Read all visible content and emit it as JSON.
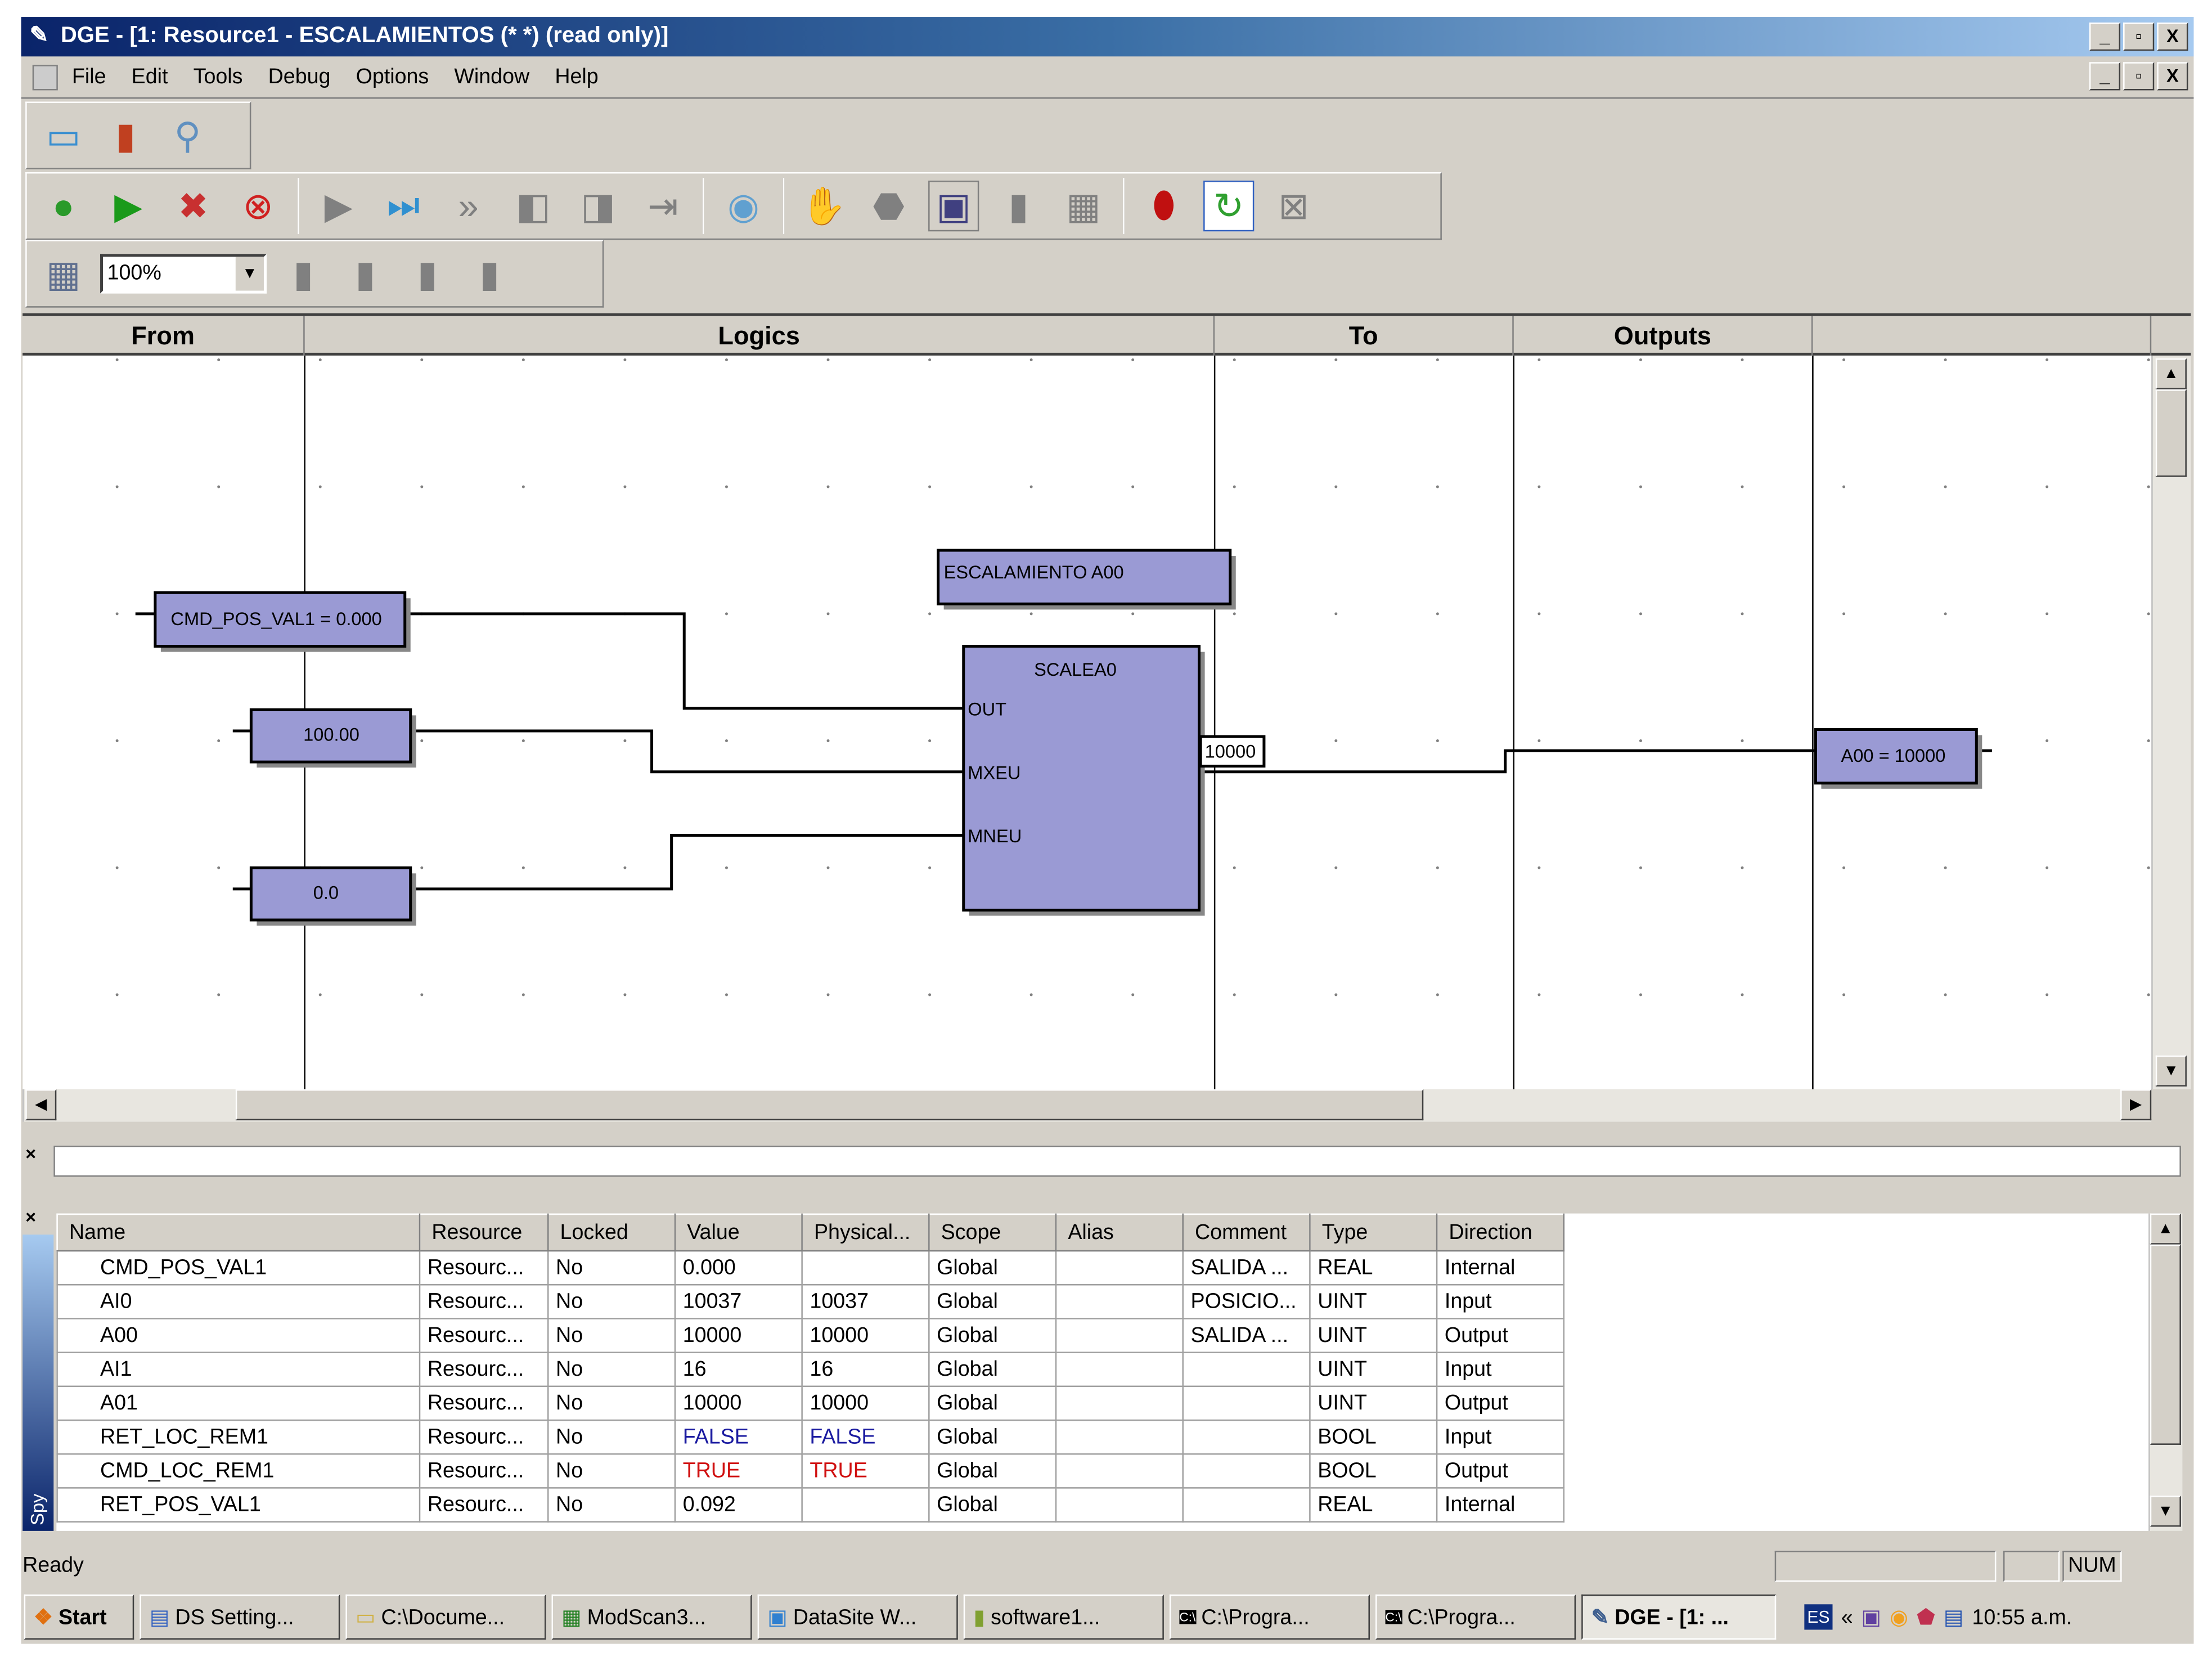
{
  "window": {
    "title": "DGE - [1: Resource1 - ESCALAMIENTOS (* *) (read only)]",
    "min": "_",
    "restore": "▫",
    "close": "X"
  },
  "menu": [
    "File",
    "Edit",
    "Tools",
    "Debug",
    "Options",
    "Window",
    "Help"
  ],
  "toolbar": {
    "zoom_value": "100%"
  },
  "diagram": {
    "columns": [
      "From",
      "Logics",
      "To",
      "Outputs",
      ""
    ],
    "blocks": {
      "cmd_pos": "CMD_POS_VAL1 = 0.000",
      "mxeu_const": "100.00",
      "mneu_const": "0.0",
      "comment": "ESCALAMIENTO A00",
      "fb_name": "SCALEA0",
      "pin_out": "OUT",
      "pin_mxeu": "MXEU",
      "pin_mneu": "MNEU",
      "out_value": "10000",
      "output": "A00 = 10000"
    }
  },
  "spy": {
    "label": "Spy",
    "columns": [
      "Name",
      "Resource",
      "Locked",
      "Value",
      "Physical...",
      "Scope",
      "Alias",
      "Comment",
      "Type",
      "Direction"
    ],
    "rows": [
      [
        "CMD_POS_VAL1",
        "Resourc...",
        "No",
        "0.000",
        "",
        "Global",
        "",
        "SALIDA ...",
        "REAL",
        "Internal"
      ],
      [
        "AI0",
        "Resourc...",
        "No",
        "10037",
        "10037",
        "Global",
        "",
        "POSICIO...",
        "UINT",
        "Input"
      ],
      [
        "A00",
        "Resourc...",
        "No",
        "10000",
        "10000",
        "Global",
        "",
        "SALIDA ...",
        "UINT",
        "Output"
      ],
      [
        "AI1",
        "Resourc...",
        "No",
        "16",
        "16",
        "Global",
        "",
        "",
        "UINT",
        "Input"
      ],
      [
        "A01",
        "Resourc...",
        "No",
        "10000",
        "10000",
        "Global",
        "",
        "",
        "UINT",
        "Output"
      ],
      [
        "RET_LOC_REM1",
        "Resourc...",
        "No",
        "FALSE",
        "FALSE",
        "Global",
        "",
        "",
        "BOOL",
        "Input"
      ],
      [
        "CMD_LOC_REM1",
        "Resourc...",
        "No",
        "TRUE",
        "TRUE",
        "Global",
        "",
        "",
        "BOOL",
        "Output"
      ],
      [
        "RET_POS_VAL1",
        "Resourc...",
        "No",
        "0.092",
        "",
        "Global",
        "",
        "",
        "REAL",
        "Internal"
      ]
    ],
    "colors": {
      "FALSE": "#1a1aa0",
      "TRUE": "#d01010"
    }
  },
  "status": {
    "text": "Ready",
    "num": "NUM"
  },
  "taskbar": {
    "start": "Start",
    "items": [
      "DS Setting...",
      "C:\\Docume...",
      "ModScan3...",
      "DataSite W...",
      "software1...",
      "C:\\Progra...",
      "C:\\Progra...",
      "DGE - [1: ..."
    ],
    "lang": "ES",
    "clock": "10:55 a.m."
  }
}
